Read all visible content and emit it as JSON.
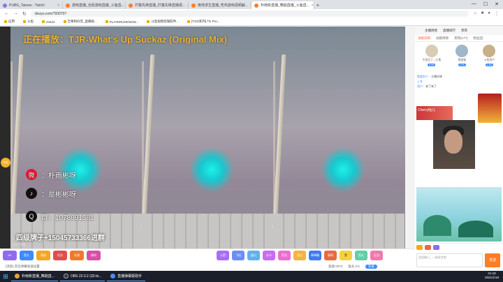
{
  "browser": {
    "tabs": [
      {
        "label": "PUBG_Taiwan - Twitch"
      },
      {
        "label": "游戏直播_全民游戏直播_斗鱼直..."
      },
      {
        "label": "拧童先锋直播_拧童先锋直播视..."
      },
      {
        "label": "绝地求生直播_吃鸡游戏视频解..."
      },
      {
        "label": "朴雨彬直播_舞蹈直播_斗鱼直..."
      }
    ],
    "url": "douyu.com/7930707",
    "bookmarks": [
      "应用",
      "斗鱼",
      "24422",
      "吉栗和抖音_直播助...",
      "PLAYERUNKNOW...",
      "斗鱼视频剪辑软件...",
      "[TGD系列] TG Pro..."
    ]
  },
  "stream": {
    "now_playing": "正在播放：TJR-What's Up Suckaz (Original Mix)",
    "weibo": "：朴雨彬呀",
    "douyin": "：是彬彬呀",
    "qq": "群：1078891581",
    "qun_notice": "四级牌子+15045733366进群",
    "side_badge": "车险",
    "danmu_status": "关注 · 弹幕"
  },
  "giftbar": {
    "items": [
      "8K",
      "鱼丸",
      "贵族",
      "任务",
      "礼物",
      "福利"
    ],
    "gifts": [
      "火箭",
      "飞机",
      "超火",
      "办卡",
      "荧光",
      "爱心",
      "棒棒糖",
      "弱鸡",
      "赞",
      "鱼丸",
      "礼包"
    ],
    "status": "[消息] 开启弹幕发送设置",
    "balance": "鱼翅 0073",
    "fish": "鱼丸 0.5",
    "recharge": "充值"
  },
  "sidebar": {
    "top_links": [
      "主播周榜",
      "直播排行",
      "贵宾"
    ],
    "tabs": [
      "贡献日榜",
      "贡献周榜",
      "贵宾(177)",
      "粉丝团"
    ],
    "fans": [
      {
        "name": "不会拉了—大奥",
        "tag": "9.9K"
      },
      {
        "name": "黑皮猫",
        "tag": "2.7K"
      },
      {
        "name": "斗鱼用户",
        "tag": "1.1K"
      }
    ],
    "chat": [
      {
        "user": "就爱别人：",
        "text": "主播好棒"
      },
      {
        "user": "上车",
        "text": ""
      },
      {
        "user": "用户",
        "text": "：来了来了"
      }
    ],
    "cherry": "Cherry咕儿",
    "input_placeholder": "这里输入，一起发言吧",
    "send": "发送"
  },
  "taskbar": {
    "apps": [
      "朴雨彬直播_舞蹈直...",
      "OBS 22.0.2 (32-bi...",
      "直播弹幕姬助手"
    ],
    "time": "21:18",
    "date": "2021/1/18"
  }
}
